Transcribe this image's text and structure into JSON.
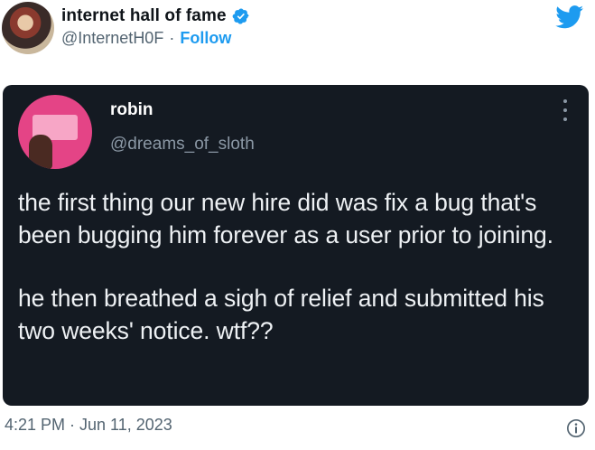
{
  "author": {
    "display_name": "internet hall of fame",
    "handle": "@InternetH0F",
    "separator": "·",
    "follow_label": "Follow"
  },
  "embedded_tweet": {
    "display_name": "robin",
    "handle": "@dreams_of_sloth",
    "paragraphs": [
      "the first thing our new hire did was fix a bug that's been bugging him forever as a user prior to joining.",
      "he then breathed a sigh of relief and submitted his two weeks' notice. wtf??"
    ]
  },
  "timestamp": "4:21 PM · Jun 11, 2023",
  "colors": {
    "accent": "#1d9bf0",
    "embedded_background": "#141a22",
    "secondary_text": "#536471"
  },
  "icons": [
    "verified-badge-icon",
    "twitter-bird-icon",
    "more-options-icon",
    "info-icon"
  ]
}
